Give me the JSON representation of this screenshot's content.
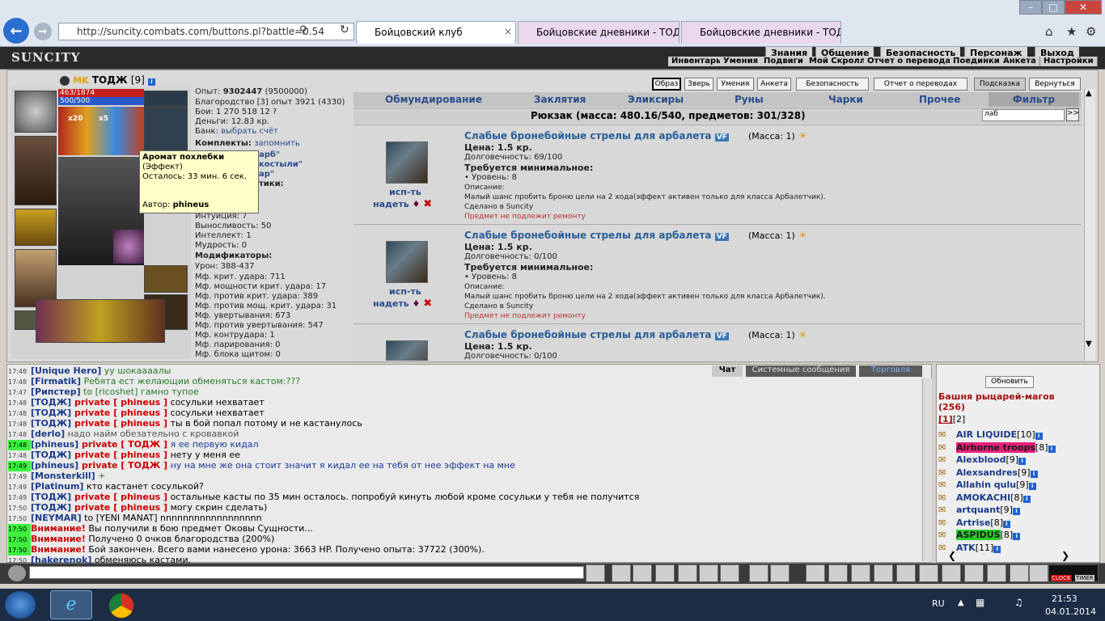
{
  "browser": {
    "url": "http://suncity.combats.com/buttons.pl?battle=0.54",
    "tabs": [
      {
        "title": "Бойцовский клуб",
        "active": true
      },
      {
        "title": "Бойцовские дневники - ТОД…",
        "active": false
      },
      {
        "title": "Бойцовские дневники - ТОДЖ",
        "active": false
      }
    ]
  },
  "game": {
    "logo": "SUNCITY",
    "topmenu": [
      "Знания",
      "Общение",
      "Безопасность",
      "Персонаж",
      "Выход"
    ],
    "submenu": [
      "Инвентарь",
      "Умения",
      "Подвиги",
      "Мой Скролл",
      "Отчет о переводах",
      "Поединки",
      "Анкета",
      "Настройки"
    ],
    "character": {
      "name": "ТОДЖ",
      "level": "[9]",
      "hp": "463/1874",
      "mana": "500/500",
      "x20": "x20",
      "x5": "x5"
    },
    "stats": {
      "exp_label": "Опыт:",
      "exp": "9302447",
      "exp_next": "(9500000)",
      "valor": "Благородство [3] опыт 3921 (4330)",
      "battles": "Бои:  1 270   518   12 ?",
      "money": "Деньги: 12.83 кр.",
      "bank_label": "Банк:",
      "bank_link": "выбрать счёт",
      "sets_label": "Комплекты:",
      "sets_remember": "запомнить",
      "intuition": "Интуиция: 7",
      "endurance": "Выносливость: 50",
      "intellect": "Интеллект: 1",
      "wisdom": "Мудрость: 0",
      "mods_label": "Модификаторы:",
      "mods": [
        "Урон: 388-437",
        "Мф. крит. удара: 711",
        "Мф. мощности крит. удара: 17",
        "Мф. против крит. удара: 389",
        "Мф. против мощ. крит. удара: 31",
        "Мф. увертывания: 673",
        "Мф. против увертывания: 547",
        "Мф. контрудара: 1",
        "Мф. парирования: 0",
        "Мф. блока щитом: 0"
      ]
    },
    "tooltip": {
      "title": "Аромат похлебки",
      "kind": "(Эффект)",
      "remain": "Осталось: 33 мин. 6 сек.",
      "author_label": "Автор:",
      "author": "phineus"
    },
    "tooltip_behind": [
      "арб\"",
      "костыли\"",
      "ар\"",
      "тики:"
    ],
    "buttons": [
      "Образ",
      "Зверь",
      "Умения",
      "Анкета",
      "Безопасность",
      "Отчет о переводах",
      "Подсказка",
      "Вернуться"
    ],
    "categories": [
      "Обмундирование",
      "Заклятия",
      "Эликсиры",
      "Руны",
      "Чарки",
      "Прочее",
      "Фильтр"
    ],
    "backpack": "Рюкзак (масса: 480.16/540, предметов: 301/328)",
    "filter_value": "лаб",
    "filter_go": ">>",
    "items": [
      {
        "name": "Слабые бронебойные стрелы для арбалета",
        "mass": "(Масса: 1)",
        "price": "Цена: 1.5 кр.",
        "durability": "Долговечность: 69/100",
        "req": "Требуется минимальное:",
        "lvl": "• Уровень: 8",
        "desc_label": "Описание:",
        "desc": "Малый шанс пробить броню цели на 2 хода(эффект активен только для класса Арбалетчик).",
        "made": "Сделано в Suncity",
        "repair": "Предмет не подлежит ремонту",
        "use": "исп-ть",
        "wear": "надеть"
      },
      {
        "name": "Слабые бронебойные стрелы для арбалета",
        "mass": "(Масса: 1)",
        "price": "Цена: 1.5 кр.",
        "durability": "Долговечность: 0/100",
        "req": "Требуется минимальное:",
        "lvl": "• Уровень: 8",
        "desc_label": "Описание:",
        "desc": "Малый шанс пробить броню цели на 2 хода(эффект активен только для класса Арбалетчик).",
        "made": "Сделано в Suncity",
        "repair": "Предмет не подлежит ремонту",
        "use": "исп-ть",
        "wear": "надеть"
      },
      {
        "name": "Слабые бронебойные стрелы для арбалета",
        "mass": "(Масса: 1)",
        "price": "Цена: 1.5 кр.",
        "durability": "Долговечность: 0/100"
      }
    ],
    "vf": "VF"
  },
  "chat": {
    "tabs": [
      "Чат",
      "Системные сообщения",
      "Торговля"
    ],
    "lines": [
      {
        "t": "17:48",
        "g": false,
        "nick": "[Unique Hero]",
        "priv": "",
        "text": " уу шокаааалы",
        "color": "green"
      },
      {
        "t": "17:48",
        "g": false,
        "nick": "[Firmatik]",
        "priv": "",
        "text": " Ребята ест желающии обменяться кастом:???",
        "color": "green"
      },
      {
        "t": "17:47",
        "g": false,
        "nick": "[Рипстер]",
        "priv": "",
        "text": " to [ricoshet] гамно тупое",
        "color": "green"
      },
      {
        "t": "17:48",
        "g": false,
        "nick": "[ТОДЖ]",
        "priv": " private [ phineus ]",
        "text": " сосульки нехватает",
        "color": "black"
      },
      {
        "t": "17:48",
        "g": false,
        "nick": "[ТОДЖ]",
        "priv": " private [ phineus ]",
        "text": " сосульки нехватает",
        "color": "black"
      },
      {
        "t": "17:48",
        "g": false,
        "nick": "[ТОДЖ]",
        "priv": " private [ phineus ]",
        "text": " ты в бой попал потому и не кастанулось",
        "color": "black"
      },
      {
        "t": "17:48",
        "g": false,
        "nick": "[derlo]",
        "priv": "",
        "text": " надо найм обезательно с кровавкой",
        "color": "gray"
      },
      {
        "t": "17:48",
        "g": true,
        "nick": "[phineus]",
        "priv": " private [ ТОДЖ ]",
        "text": " я ее первую кидал",
        "color": "blue"
      },
      {
        "t": "17:48",
        "g": false,
        "nick": "[ТОДЖ]",
        "priv": " private [ phineus ]",
        "text": " нету у меня ее",
        "color": "black"
      },
      {
        "t": "17:49",
        "g": true,
        "nick": "[phineus]",
        "priv": " private [ ТОДЖ ]",
        "text": " ну на мне же она стоит значит я кидал ее на тебя от нее эффект на мне",
        "color": "blue"
      },
      {
        "t": "17:49",
        "g": false,
        "nick": "[Monsterkill]",
        "priv": "",
        "text": " +",
        "color": "green"
      },
      {
        "t": "17:49",
        "g": false,
        "nick": "[Platinum]",
        "priv": "",
        "text": " кто кастанет сосулькой?",
        "color": "black"
      },
      {
        "t": "17:49",
        "g": false,
        "nick": "[ТОДЖ]",
        "priv": " private [ phineus ]",
        "text": " остальные касты по 35 мин осталось. попробуй кинуть любой кроме сосульки у тебя не получится",
        "color": "black"
      },
      {
        "t": "17:50",
        "g": false,
        "nick": "[ТОДЖ]",
        "priv": " private [ phineus ]",
        "text": " могу скрин сделать)",
        "color": "black"
      },
      {
        "t": "17:50",
        "g": false,
        "nick": "[NEYMAR]",
        "priv": "",
        "text": " to [YENI MANAT] nnnnnnnnnnnnnnnnnn",
        "color": "black"
      },
      {
        "t": "17:50",
        "g": true,
        "nick": "",
        "priv": "Внимание!",
        "text": " Вы получили в бою предмет Оковы Сущности...",
        "color": "black"
      },
      {
        "t": "17:50",
        "g": true,
        "nick": "",
        "priv": "Внимание!",
        "text": " Получено 0 очков благородства (200%)",
        "color": "black"
      },
      {
        "t": "17:50",
        "g": true,
        "nick": "",
        "priv": "Внимание!",
        "text": " Бой закончен. Всего вами нанесено урона: 3663 HP. Получено опыта: 37722 (300%).",
        "color": "black"
      },
      {
        "t": "17:50",
        "g": false,
        "nick": "[hakerenok]",
        "priv": "",
        "text": " обменяюсь кастами.",
        "color": "black"
      }
    ]
  },
  "online": {
    "refresh": "Обновить",
    "room": "Башня рыцарей-магов",
    "count": "(256)",
    "pages": [
      "[1]",
      "[2]"
    ],
    "users": [
      {
        "name": "AIR LIQUIDE",
        "lvl": "[10]"
      },
      {
        "name": "Airborne troops",
        "lvl": "[8]"
      },
      {
        "name": "Alexblood",
        "lvl": "[9]"
      },
      {
        "name": "Alexsandres",
        "lvl": "[9]"
      },
      {
        "name": "Allahin qulu",
        "lvl": "[9]"
      },
      {
        "name": "AMOKACHI",
        "lvl": "[8]"
      },
      {
        "name": "artquant",
        "lvl": "[9]"
      },
      {
        "name": "Artrise",
        "lvl": "[8]"
      },
      {
        "name": "ASPIDUS",
        "lvl": "[8]"
      },
      {
        "name": "ATK",
        "lvl": "[11]"
      }
    ]
  },
  "clock": {
    "label": "CLOCK",
    "timer": "TIMER"
  },
  "taskbar": {
    "lang": "RU",
    "time": "21:53",
    "date": "04.01.2014"
  }
}
